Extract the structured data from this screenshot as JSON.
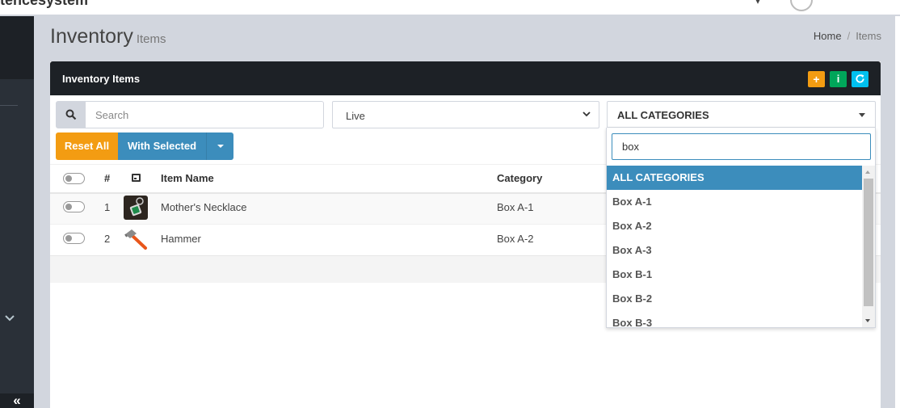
{
  "header": {
    "brand": "tencesystem"
  },
  "page": {
    "title": "Inventory",
    "subtitle": "Items"
  },
  "breadcrumb": {
    "home": "Home",
    "current": "Items"
  },
  "box": {
    "title": "Inventory Items",
    "buttons": {
      "add": "+",
      "info": "i",
      "refresh": "C"
    }
  },
  "filters": {
    "search_placeholder": "Search",
    "status_value": "Live",
    "category_value": "ALL CATEGORIES"
  },
  "actions": {
    "reset_label": "Reset All",
    "with_selected_label": "With Selected"
  },
  "table": {
    "columns": {
      "num": "#",
      "name": "Item Name",
      "category": "Category"
    },
    "rows": [
      {
        "num": "1",
        "name": "Mother's Necklace",
        "category": "Box A-1"
      },
      {
        "num": "2",
        "name": "Hammer",
        "category": "Box A-2"
      }
    ]
  },
  "dropdown": {
    "search_value": "box",
    "options": [
      "ALL CATEGORIES",
      "Box A-1",
      "Box A-2",
      "Box A-3",
      "Box B-1",
      "Box B-2",
      "Box B-3"
    ],
    "highlighted": "ALL CATEGORIES"
  },
  "colors": {
    "primary": "#3c8dbc",
    "warning": "#f39c12",
    "success": "#00a65a",
    "info": "#00c0ef",
    "dark": "#1d2126"
  }
}
